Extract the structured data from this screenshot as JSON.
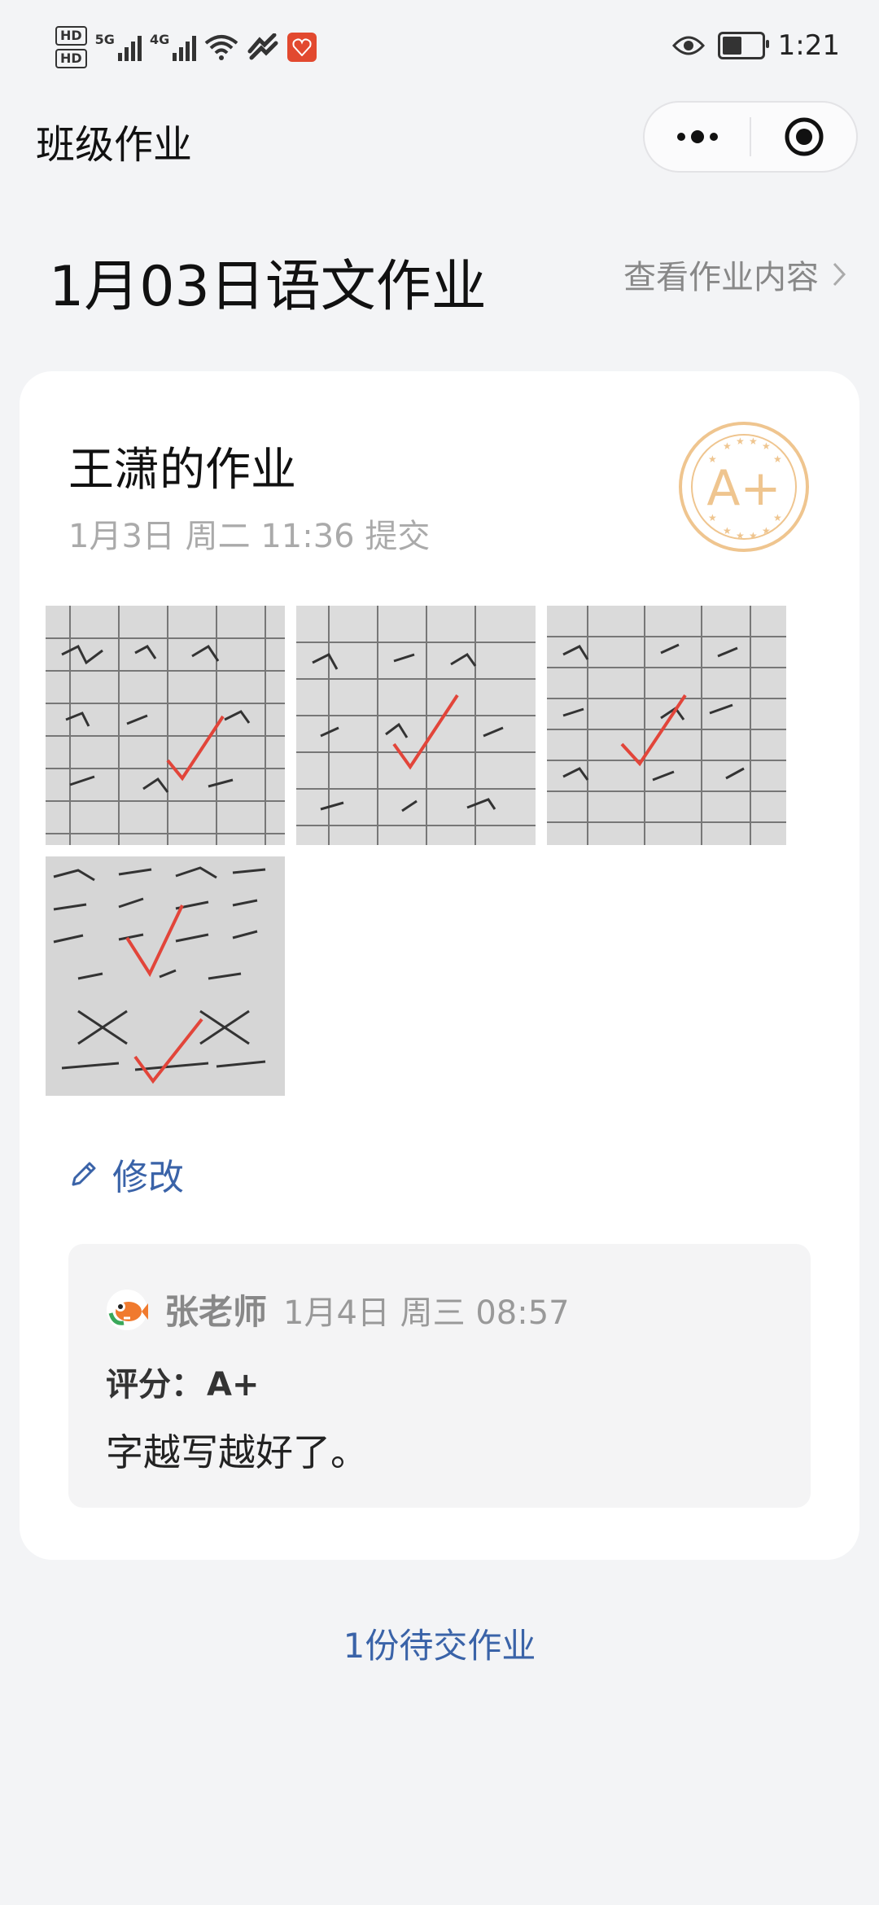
{
  "status_bar": {
    "hd1": "HD",
    "hd2": "HD",
    "net1": "5G",
    "net2": "4G",
    "time": "1:21",
    "battery_level": 0.5
  },
  "nav": {
    "title": "班级作业"
  },
  "header": {
    "homework_title": "1月03日语文作业",
    "view_content_label": "查看作业内容"
  },
  "submission": {
    "student_title": "王潇的作业",
    "submit_time": "1月3日 周二 11:36 提交",
    "grade": "A+",
    "images": [
      {
        "name": "homework-image-1"
      },
      {
        "name": "homework-image-2"
      },
      {
        "name": "homework-image-3"
      },
      {
        "name": "homework-image-4"
      }
    ],
    "edit_label": "修改"
  },
  "comment": {
    "teacher": "张老师",
    "time": "1月4日 周三 08:57",
    "score_label": "评分：",
    "score_value": "A+",
    "text": "字越写越好了。"
  },
  "footer": {
    "pending_label": "1份待交作业"
  },
  "colors": {
    "accent_blue": "#3a63a8",
    "stamp": "#efc58f",
    "check_red": "#e2453a"
  }
}
